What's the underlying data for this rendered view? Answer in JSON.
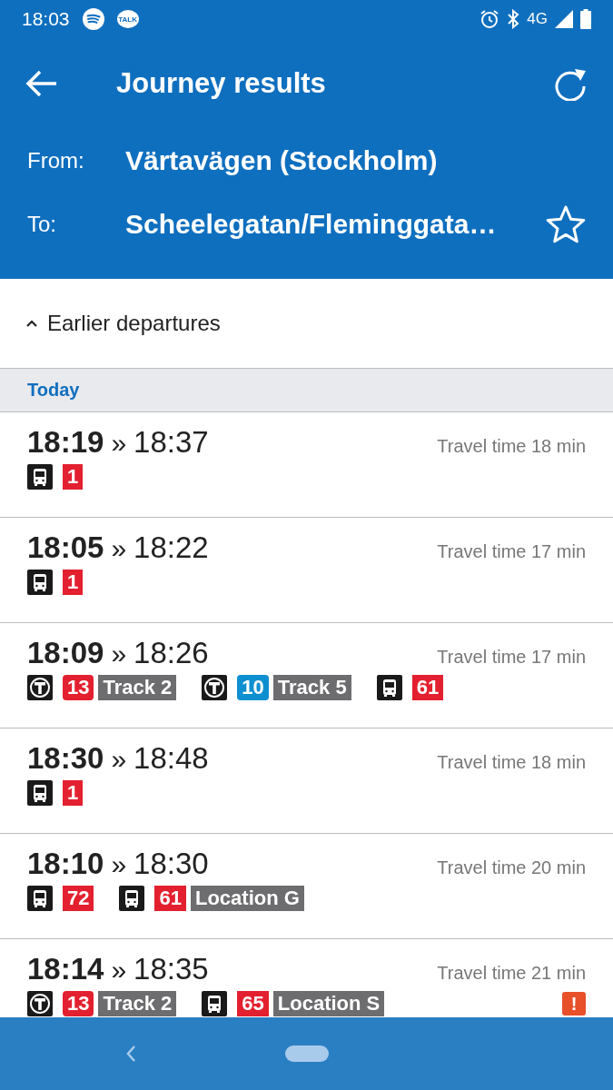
{
  "status_bar": {
    "time": "18:03",
    "talk_label": "TALK",
    "network": "4G"
  },
  "header": {
    "title": "Journey results",
    "from_label": "From:",
    "from": "Värtavägen (Stockholm)",
    "to_label": "To:",
    "to": "Scheelegatan/Fleminggata…",
    "favorite": false
  },
  "earlier": {
    "label": "Earlier departures"
  },
  "section": {
    "label": "Today"
  },
  "journeys": [
    {
      "depart": "18:19",
      "sep": "»",
      "arrive": "18:37",
      "travel_time": "Travel time 18 min",
      "legs": [
        {
          "kind": "bus",
          "line": "1",
          "color": "#e3202f"
        }
      ]
    },
    {
      "depart": "18:05",
      "sep": "»",
      "arrive": "18:22",
      "travel_time": "Travel time 17 min",
      "legs": [
        {
          "kind": "bus",
          "line": "1",
          "color": "#e3202f"
        }
      ]
    },
    {
      "depart": "18:09",
      "sep": "»",
      "arrive": "18:26",
      "travel_time": "Travel time 17 min",
      "legs": [
        {
          "kind": "metro",
          "line": "13",
          "color": "#e3202f",
          "stop": "Track 2"
        },
        {
          "kind": "metro",
          "line": "10",
          "color": "#0e8fd0",
          "stop": "Track 5"
        },
        {
          "kind": "bus",
          "line": "61",
          "color": "#e3202f"
        }
      ]
    },
    {
      "depart": "18:30",
      "sep": "»",
      "arrive": "18:48",
      "travel_time": "Travel time 18 min",
      "legs": [
        {
          "kind": "bus",
          "line": "1",
          "color": "#e3202f"
        }
      ]
    },
    {
      "depart": "18:10",
      "sep": "»",
      "arrive": "18:30",
      "travel_time": "Travel time 20 min",
      "legs": [
        {
          "kind": "bus",
          "line": "72",
          "color": "#e3202f"
        },
        {
          "kind": "bus",
          "line": "61",
          "color": "#e3202f",
          "stop": "Location G"
        }
      ]
    },
    {
      "depart": "18:14",
      "sep": "»",
      "arrive": "18:35",
      "travel_time": "Travel time 21 min",
      "alert": "!",
      "legs": [
        {
          "kind": "metro",
          "line": "13",
          "color": "#e3202f",
          "stop": "Track 2"
        },
        {
          "kind": "bus",
          "line": "65",
          "color": "#e3202f",
          "stop": "Location S"
        }
      ]
    }
  ]
}
